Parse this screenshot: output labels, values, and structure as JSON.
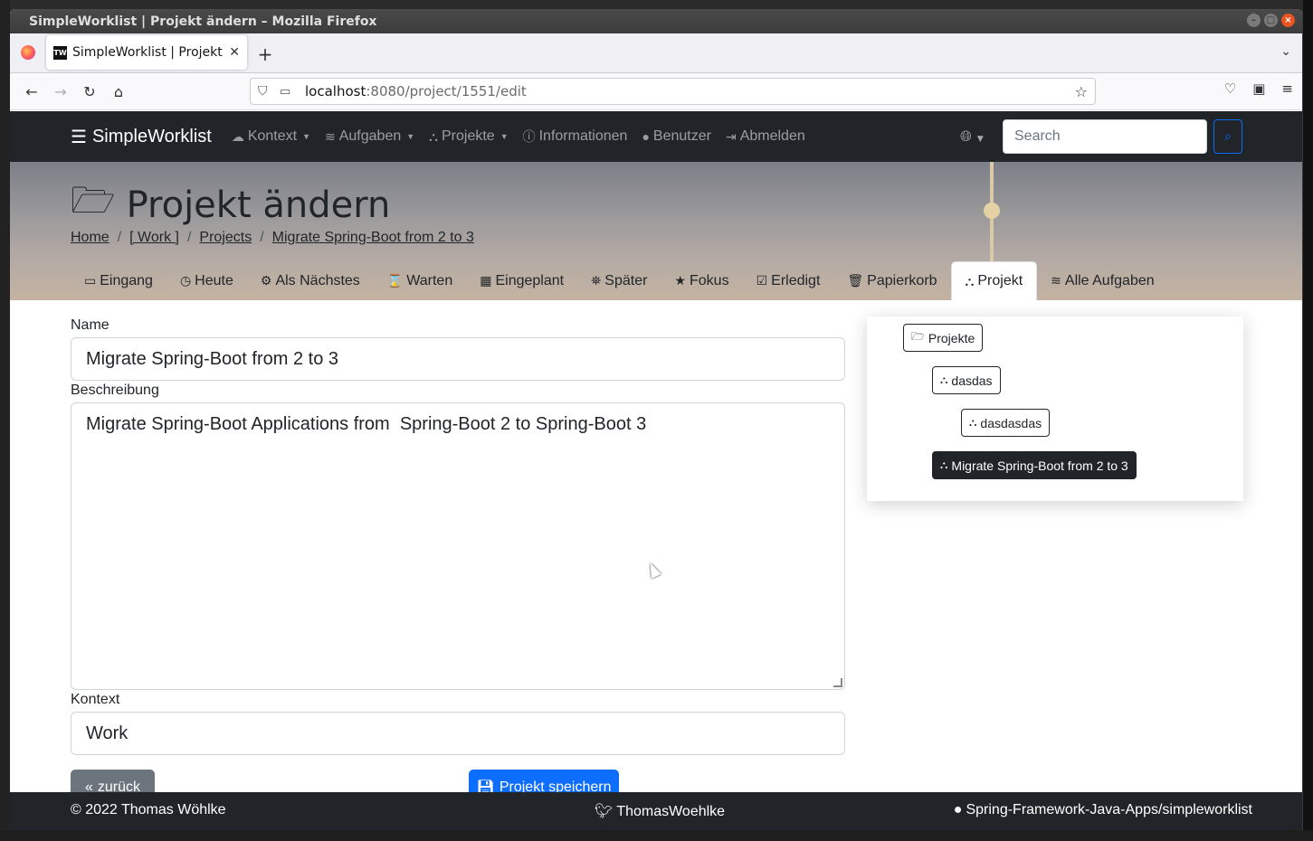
{
  "window": {
    "title": "SimpleWorklist | Projekt ändern – Mozilla Firefox"
  },
  "browser": {
    "tab_title": "SimpleWorklist | Projekt",
    "tab_favicon": "TW",
    "url_host": "localhost",
    "url_path": ":8080/project/1551/edit"
  },
  "app": {
    "brand": "SimpleWorklist",
    "nav": {
      "kontext": "Kontext",
      "aufgaben": "Aufgaben",
      "projekte": "Projekte",
      "informationen": "Informationen",
      "benutzer": "Benutzer",
      "abmelden": "Abmelden"
    },
    "search_placeholder": "Search"
  },
  "page": {
    "title": "Projekt ändern",
    "breadcrumb": [
      "Home",
      "[ Work ]",
      "Projects",
      "Migrate Spring-Boot from 2 to 3"
    ],
    "tabs": [
      {
        "label": "Eingang",
        "icon": "inbox-icon"
      },
      {
        "label": "Heute",
        "icon": "clock-icon"
      },
      {
        "label": "Als Nächstes",
        "icon": "gears-icon"
      },
      {
        "label": "Warten",
        "icon": "hourglass-icon"
      },
      {
        "label": "Eingeplant",
        "icon": "calendar-icon"
      },
      {
        "label": "Später",
        "icon": "binoculars-icon"
      },
      {
        "label": "Fokus",
        "icon": "star-icon"
      },
      {
        "label": "Erledigt",
        "icon": "check-square-icon"
      },
      {
        "label": "Papierkorb",
        "icon": "trash-icon"
      },
      {
        "label": "Projekt",
        "icon": "project-diagram-icon",
        "active": true
      },
      {
        "label": "Alle Aufgaben",
        "icon": "database-icon"
      }
    ]
  },
  "form": {
    "name_label": "Name",
    "name_value": "Migrate Spring-Boot from 2 to 3",
    "description_label": "Beschreibung",
    "description_value": "Migrate Spring-Boot Applications from  Spring-Boot 2 to Spring-Boot 3",
    "context_label": "Kontext",
    "context_value": "Work",
    "back_label": "zurück",
    "save_label": "Projekt speichern"
  },
  "tree": {
    "root": "Projekte",
    "level1": "dasdas",
    "level2": "dasdasdas",
    "current": "Migrate Spring-Boot from 2 to 3"
  },
  "footer": {
    "copyright": "© 2022 Thomas Wöhlke",
    "twitter": "ThomasWoehlke",
    "github": "Spring-Framework-Java-Apps/simpleworklist"
  },
  "colors": {
    "navbar": "#212529",
    "primary": "#0d6efd",
    "secondary": "#6c757d"
  }
}
